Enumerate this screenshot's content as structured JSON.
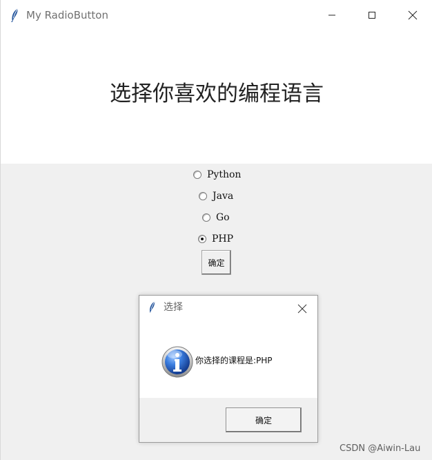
{
  "window": {
    "title": "My RadioButton",
    "heading": "选择你喜欢的编程语言"
  },
  "options": [
    {
      "label": "Python",
      "selected": false
    },
    {
      "label": "Java",
      "selected": false
    },
    {
      "label": "Go",
      "selected": false
    },
    {
      "label": "PHP",
      "selected": true
    }
  ],
  "buttons": {
    "confirm": "确定"
  },
  "dialog": {
    "title": "选择",
    "message": "你选择的课程是:PHP",
    "ok_button": "确定"
  },
  "watermark": "CSDN @Aiwin-Lau",
  "icons": {
    "app": "feather-icon",
    "minimize": "minimize-icon",
    "maximize": "maximize-icon",
    "close": "close-icon",
    "info": "info-icon"
  },
  "colors": {
    "window_background": "#f0f0f0",
    "title_background": "#ffffff",
    "dialog_background": "#f0f0f0",
    "info_blue": "#2f63b8"
  }
}
